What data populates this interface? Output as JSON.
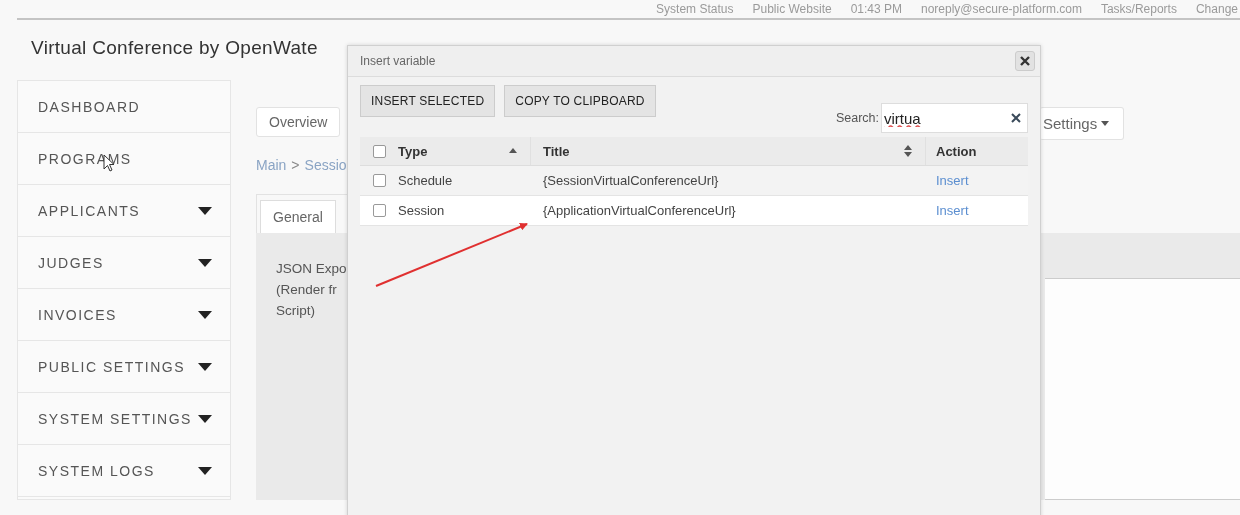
{
  "top_links": [
    "System Status",
    "Public Website",
    "01:43 PM",
    "noreply@secure-platform.com",
    "Tasks/Reports",
    "Change"
  ],
  "page_title": "Virtual Conference by OpenWate",
  "sidebar": {
    "items": [
      {
        "label": "DASHBOARD",
        "has_caret": false
      },
      {
        "label": "PROGRAMS",
        "has_caret": false
      },
      {
        "label": "APPLICANTS",
        "has_caret": true
      },
      {
        "label": "JUDGES",
        "has_caret": true
      },
      {
        "label": "INVOICES",
        "has_caret": true
      },
      {
        "label": "PUBLIC SETTINGS",
        "has_caret": true
      },
      {
        "label": "SYSTEM SETTINGS",
        "has_caret": true
      },
      {
        "label": "SYSTEM LOGS",
        "has_caret": true
      }
    ]
  },
  "toolbar": {
    "overview": "Overview",
    "settings": "Settings"
  },
  "breadcrumb": {
    "main": "Main",
    "separator": ">",
    "current": "Sessio"
  },
  "tabs": [
    {
      "label": "General",
      "selected": true
    }
  ],
  "field_label": [
    "JSON Expo",
    "(Render fr",
    "Script)"
  ],
  "modal": {
    "title": "Insert variable",
    "buttons": [
      "INSERT SELECTED",
      "COPY TO CLIPBOARD"
    ],
    "search": {
      "label": "Search:",
      "value": "virtua"
    },
    "columns": [
      {
        "label": "Type",
        "kind": "ascending"
      },
      {
        "label": "Title",
        "kind": "sortable"
      },
      {
        "label": "Action",
        "kind": "plain"
      }
    ],
    "all_checked": false,
    "rows": [
      {
        "checked": false,
        "type": "Schedule",
        "title": "{SessionVirtualConferenceUrl}",
        "action": "Insert"
      },
      {
        "checked": false,
        "type": "Session",
        "title": "{ApplicationVirtualConferenceUrl}",
        "action": "Insert"
      }
    ]
  }
}
